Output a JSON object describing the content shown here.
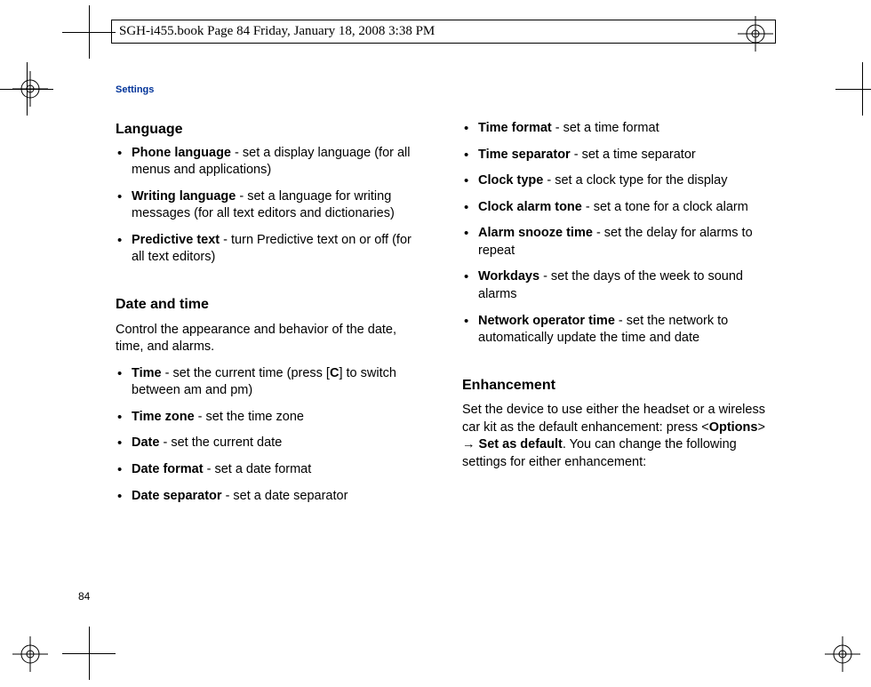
{
  "header": "SGH-i455.book  Page 84  Friday, January 18, 2008  3:38 PM",
  "sectionLabel": "Settings",
  "pageNumber": "84",
  "left": {
    "heading1": "Language",
    "items1": [
      {
        "term": "Phone language",
        "desc": " - set a display language (for all menus and applications)"
      },
      {
        "term": "Writing language",
        "desc": " - set a language for writing messages (for all text editors and dictionaries)"
      },
      {
        "term": "Predictive text",
        "desc": " - turn Predictive text on or off (for all text editors)"
      }
    ],
    "heading2": "Date and time",
    "intro2": "Control the appearance and behavior of the date, time, and alarms.",
    "items2": [
      {
        "term": "Time",
        "desc_a": " - set the current time (press [",
        "key": "C",
        "desc_b": "] to switch between am and pm)"
      },
      {
        "term": "Time zone",
        "desc": " - set the time zone"
      },
      {
        "term": "Date",
        "desc": " - set the current date"
      },
      {
        "term": "Date format",
        "desc": " - set a date format"
      },
      {
        "term": "Date separator",
        "desc": " - set a date separator"
      }
    ]
  },
  "right": {
    "items1": [
      {
        "term": "Time format",
        "desc": " - set a time format"
      },
      {
        "term": "Time separator",
        "desc": " - set a time separator"
      },
      {
        "term": "Clock type",
        "desc": " - set a clock type for the display"
      },
      {
        "term": "Clock alarm tone",
        "desc": " - set a tone for a clock alarm"
      },
      {
        "term": "Alarm snooze time",
        "desc": " - set the delay for alarms to repeat"
      },
      {
        "term": "Workdays",
        "desc": " - set the days of the week to sound alarms"
      },
      {
        "term": "Network operator time",
        "desc": " - set the network to automatically update the time and date"
      }
    ],
    "heading2": "Enhancement",
    "enh_a": "Set the device to use either the headset or a wireless car kit as the default enhancement: press <",
    "enh_opt": "Options",
    "enh_b": "> → ",
    "enh_set": "Set as default",
    "enh_c": ". You can change the following settings for either enhancement:"
  }
}
